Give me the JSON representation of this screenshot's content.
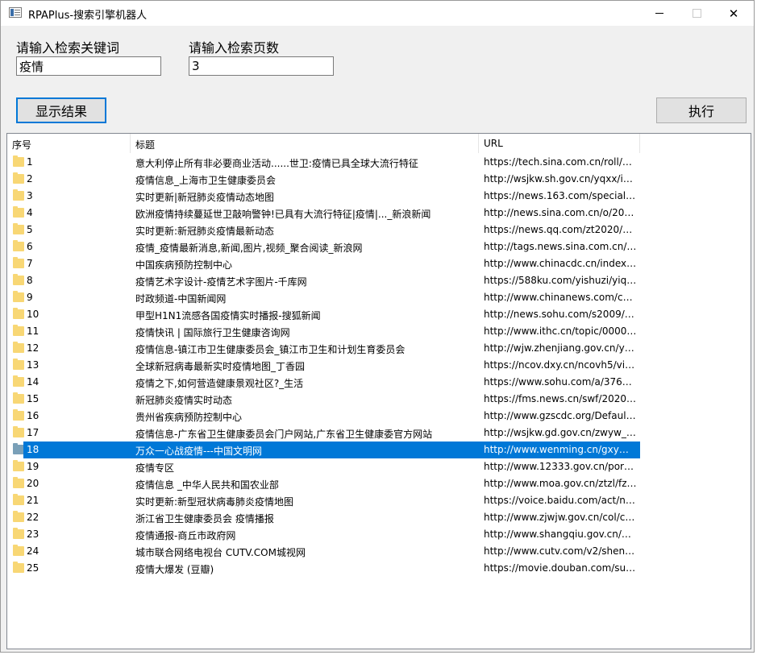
{
  "window": {
    "title": "RPAPlus-搜索引擎机器人"
  },
  "form": {
    "keyword_label": "请输入检索关键词",
    "keyword_value": "疫情",
    "pages_label": "请输入检索页数",
    "pages_value": "3",
    "show_button": "显示结果",
    "run_button": "执行"
  },
  "table": {
    "columns": [
      "序号",
      "标题",
      "URL"
    ],
    "selected_index": 17,
    "rows": [
      {
        "idx": "1",
        "title": "意大利停止所有非必要商业活动......世卫:疫情已具全球大流行特征",
        "url": "https://tech.sina.com.cn/roll/20..."
      },
      {
        "idx": "2",
        "title": "疫情信息_上海市卫生健康委员会",
        "url": "http://wsjkw.sh.gov.cn/yqxx/in..."
      },
      {
        "idx": "3",
        "title": "实时更新|新冠肺炎疫情动态地图",
        "url": "https://news.163.com/special/..."
      },
      {
        "idx": "4",
        "title": "欧洲疫情持续蔓延世卫敲响警钟!已具有大流行特征|疫情|..._新浪新闻",
        "url": "http://news.sina.com.cn/o/202..."
      },
      {
        "idx": "5",
        "title": "实时更新:新冠肺炎疫情最新动态",
        "url": "https://news.qq.com/zt2020/p..."
      },
      {
        "idx": "6",
        "title": "疫情_疫情最新消息,新闻,图片,视频_聚合阅读_新浪网",
        "url": "http://tags.news.sina.com.cn/%..."
      },
      {
        "idx": "7",
        "title": "中国疾病预防控制中心",
        "url": "http://www.chinacdc.cn/index.h..."
      },
      {
        "idx": "8",
        "title": "疫情艺术字设计-疫情艺术字图片-千库网",
        "url": "https://588ku.com/yishuzi/yiqi..."
      },
      {
        "idx": "9",
        "title": "时政频道-中国新闻网",
        "url": "http://www.chinanews.com/chi..."
      },
      {
        "idx": "10",
        "title": "甲型H1N1流感各国疫情实时播报-搜狐新闻",
        "url": "http://news.sohu.com/s2009/2..."
      },
      {
        "idx": "11",
        "title": "疫情快讯 | 国际旅行卫生健康咨询网",
        "url": "http://www.ithc.cn/topic/00003..."
      },
      {
        "idx": "12",
        "title": "疫情信息-镇江市卫生健康委员会_镇江市卫生和计划生育委员会",
        "url": "http://wjw.zhenjiang.gov.cn/yw..."
      },
      {
        "idx": "13",
        "title": "全球新冠病毒最新实时疫情地图_丁香园",
        "url": "https://ncov.dxy.cn/ncovh5/vie..."
      },
      {
        "idx": "14",
        "title": "疫情之下,如何营造健康景观社区?_生活",
        "url": "https://www.sohu.com/a/3766..."
      },
      {
        "idx": "15",
        "title": "新冠肺炎疫情实时动态",
        "url": "https://fms.news.cn/swf/2020_sj..."
      },
      {
        "idx": "16",
        "title": "贵州省疾病预防控制中心",
        "url": "http://www.gzscdc.org/Default...."
      },
      {
        "idx": "17",
        "title": "疫情信息-广东省卫生健康委员会门户网站,广东省卫生健康委官方网站",
        "url": "http://wsjkw.gd.gov.cn/zwyw_y..."
      },
      {
        "idx": "18",
        "title": "万众一心战疫情---中国文明网",
        "url": "http://www.wenming.cn/gxym/..."
      },
      {
        "idx": "19",
        "title": "疫情专区",
        "url": "http://www.12333.gov.cn/porta..."
      },
      {
        "idx": "20",
        "title": "疫情信息 _中华人民共和国农业部",
        "url": "http://www.moa.gov.cn/ztzl/fzz..."
      },
      {
        "idx": "21",
        "title": "实时更新:新型冠状病毒肺炎疫情地图",
        "url": "https://voice.baidu.com/act/ne..."
      },
      {
        "idx": "22",
        "title": "浙江省卫生健康委员会 疫情播报",
        "url": "http://www.zjwjw.gov.cn/col/co..."
      },
      {
        "idx": "23",
        "title": "疫情通报-商丘市政府网",
        "url": "http://www.shangqiu.gov.cn/C..."
      },
      {
        "idx": "24",
        "title": "城市联合网络电视台 CUTV.COM城视网",
        "url": "http://www.cutv.com/v2/shenz..."
      },
      {
        "idx": "25",
        "title": "疫情大爆发 (豆瓣)",
        "url": "https://movie.douban.com/sub..."
      }
    ]
  }
}
